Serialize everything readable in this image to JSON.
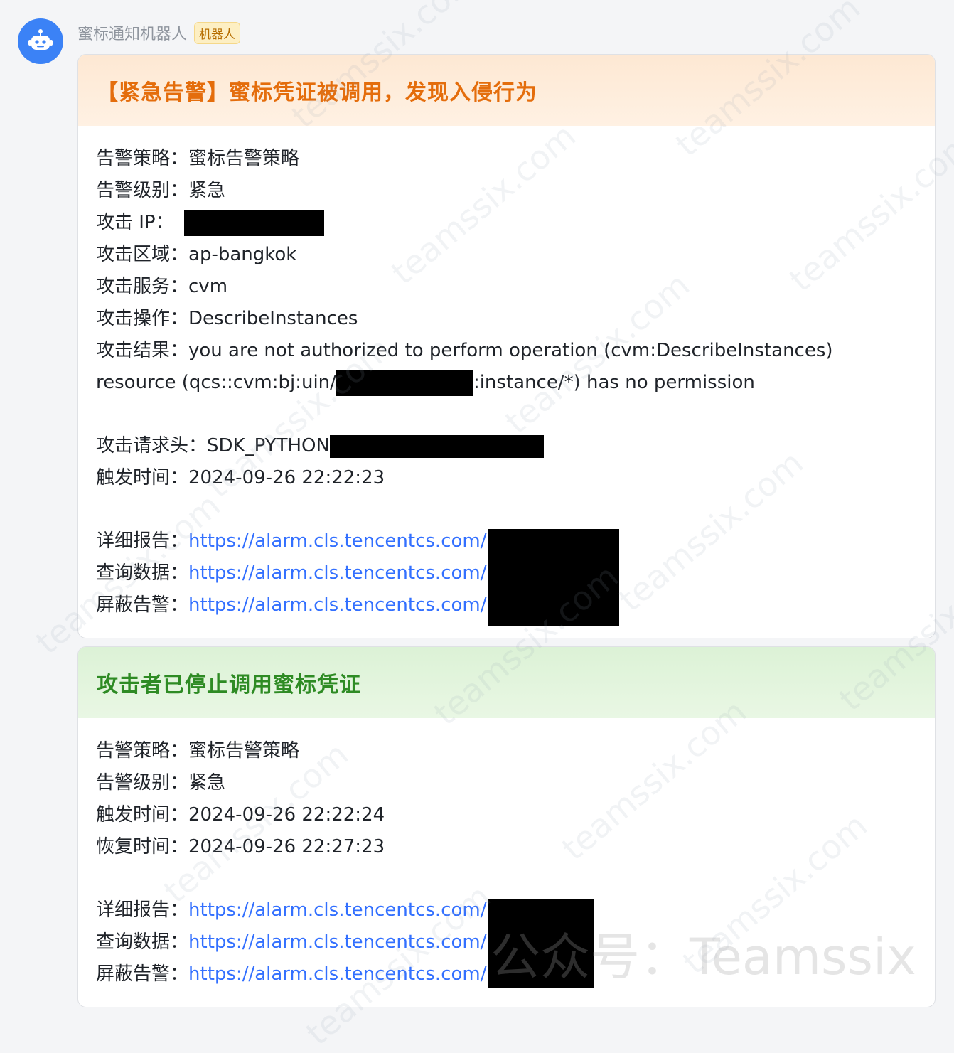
{
  "sender": {
    "name": "蜜标通知机器人",
    "badge": "机器人",
    "avatar_icon": "robot-icon"
  },
  "alert_card": {
    "title": "【紧急告警】蜜标凭证被调用，发现入侵行为",
    "fields": [
      {
        "label": "告警策略：",
        "value": "蜜标告警策略"
      },
      {
        "label": "告警级别：",
        "value": "紧急"
      },
      {
        "label": "攻击 IP：",
        "value": ""
      },
      {
        "label": "攻击区域：",
        "value": "ap-bangkok"
      },
      {
        "label": "攻击服务：",
        "value": "cvm"
      },
      {
        "label": "攻击操作：",
        "value": "DescribeInstances"
      },
      {
        "label": "攻击结果：",
        "value": "you are not authorized to perform operation (cvm:DescribeInstances)"
      }
    ],
    "result_line2_prefix": "resource (qcs::cvm:bj:uin/",
    "result_line2_suffix": ":instance/*) has no permission",
    "request_header": {
      "label": "攻击请求头：",
      "value": "SDK_PYTHON"
    },
    "trigger_time": {
      "label": "触发时间：",
      "value": "2024-09-26 22:22:23"
    },
    "links": [
      {
        "label": "详细报告：",
        "url": "https://alarm.cls.tencentcs.com/"
      },
      {
        "label": "查询数据：",
        "url": "https://alarm.cls.tencentcs.com/"
      },
      {
        "label": "屏蔽告警：",
        "url": "https://alarm.cls.tencentcs.com/"
      }
    ]
  },
  "recover_card": {
    "title": "攻击者已停止调用蜜标凭证",
    "fields": [
      {
        "label": "告警策略：",
        "value": "蜜标告警策略"
      },
      {
        "label": "告警级别：",
        "value": "紧急"
      },
      {
        "label": "触发时间：",
        "value": "2024-09-26 22:22:24"
      },
      {
        "label": "恢复时间：",
        "value": "2024-09-26 22:27:23"
      }
    ],
    "links": [
      {
        "label": "详细报告：",
        "url": "https://alarm.cls.tencentcs.com/"
      },
      {
        "label": "查询数据：",
        "url": "https://alarm.cls.tencentcs.com/"
      },
      {
        "label": "屏蔽告警：",
        "url": "https://alarm.cls.tencentcs.com/"
      }
    ]
  },
  "watermark": {
    "text": "teamssix.com",
    "footer": "公众号：Teamssix"
  },
  "colors": {
    "alert_title": "#e46d0c",
    "recover_title": "#2e8b24",
    "link": "#3370ff",
    "avatar_bg": "#3b82f6"
  }
}
